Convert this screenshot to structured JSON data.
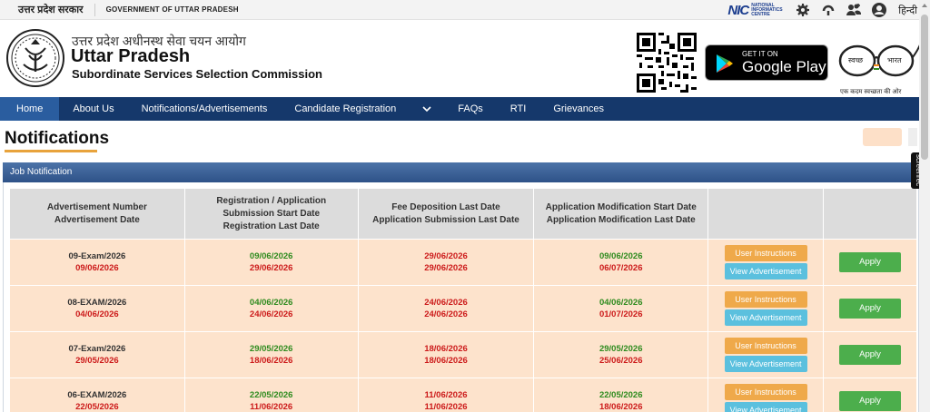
{
  "topbar": {
    "hindi_label": "उत्तर प्रदेश सरकार",
    "gov_label": "GOVERNMENT OF UTTAR PRADESH",
    "nic_short": "NIC",
    "nic_full": "NATIONAL INFORMATICS CENTRE",
    "lang_label": "हिन्दी",
    "icons": [
      "settings-icon",
      "accessibility-icon",
      "users-icon",
      "user-circle-icon"
    ]
  },
  "header": {
    "org_hindi": "उत्तर प्रदेश अधीनस्थ सेवा चयन आयोग",
    "org_title": "Uttar Pradesh",
    "org_subtitle": "Subordinate Services Selection Commission",
    "gplay_get": "GET IT ON",
    "gplay_name": "Google Play",
    "swachh_word1": "स्वच्छ",
    "swachh_word2": "भारत",
    "swachh_tag": "एक कदम स्वच्छता की ओर"
  },
  "nav": {
    "items": [
      "Home",
      "About Us",
      "Notifications/Advertisements",
      "Candidate Registration",
      "FAQs",
      "RTI",
      "Grievances"
    ]
  },
  "page": {
    "title": "Notifications",
    "panel_title": "Job Notification"
  },
  "table": {
    "headers": {
      "col1": "Advertisement Number\nAdvertisement Date",
      "col2": "Registration / Application Submission  Start Date\nRegistration Last Date",
      "col3": "Fee Deposition Last Date\nApplication Submission Last Date",
      "col4": "Application Modification Start Date\nApplication Modification Last Date"
    },
    "rows": [
      {
        "adv_no": "09-Exam/2026",
        "adv_date": "09/06/2026",
        "reg_start": "09/06/2026",
        "reg_last": "29/06/2026",
        "fee_last": "29/06/2026",
        "sub_last": "29/06/2026",
        "mod_start": "09/06/2026",
        "mod_last": "06/07/2026"
      },
      {
        "adv_no": "08-EXAM/2026",
        "adv_date": "04/06/2026",
        "reg_start": "04/06/2026",
        "reg_last": "24/06/2026",
        "fee_last": "24/06/2026",
        "sub_last": "24/06/2026",
        "mod_start": "04/06/2026",
        "mod_last": "01/07/2026"
      },
      {
        "adv_no": "07-Exam/2026",
        "adv_date": "29/05/2026",
        "reg_start": "29/05/2026",
        "reg_last": "18/06/2026",
        "fee_last": "18/06/2026",
        "sub_last": "18/06/2026",
        "mod_start": "29/05/2026",
        "mod_last": "25/06/2026"
      },
      {
        "adv_no": "06-EXAM/2026",
        "adv_date": "22/05/2026",
        "reg_start": "22/05/2026",
        "reg_last": "11/06/2026",
        "fee_last": "11/06/2026",
        "sub_last": "11/06/2026",
        "mod_start": "22/05/2026",
        "mod_last": "18/06/2026"
      }
    ],
    "btn_user_instructions": "User Instructions",
    "btn_view_ad": "View Advertisement",
    "btn_apply": "Apply"
  },
  "overlay": {
    "screenrec": "screenrec"
  },
  "colors": {
    "nav_bg": "#15386b",
    "nav_active": "#2a5d9f",
    "row_bg": "#fde3cc",
    "date_green": "#2e8b1e",
    "date_red": "#cc1a1a",
    "btn_orange": "#efa94a",
    "btn_blue": "#5bc0de",
    "btn_green": "#4cae4c"
  }
}
